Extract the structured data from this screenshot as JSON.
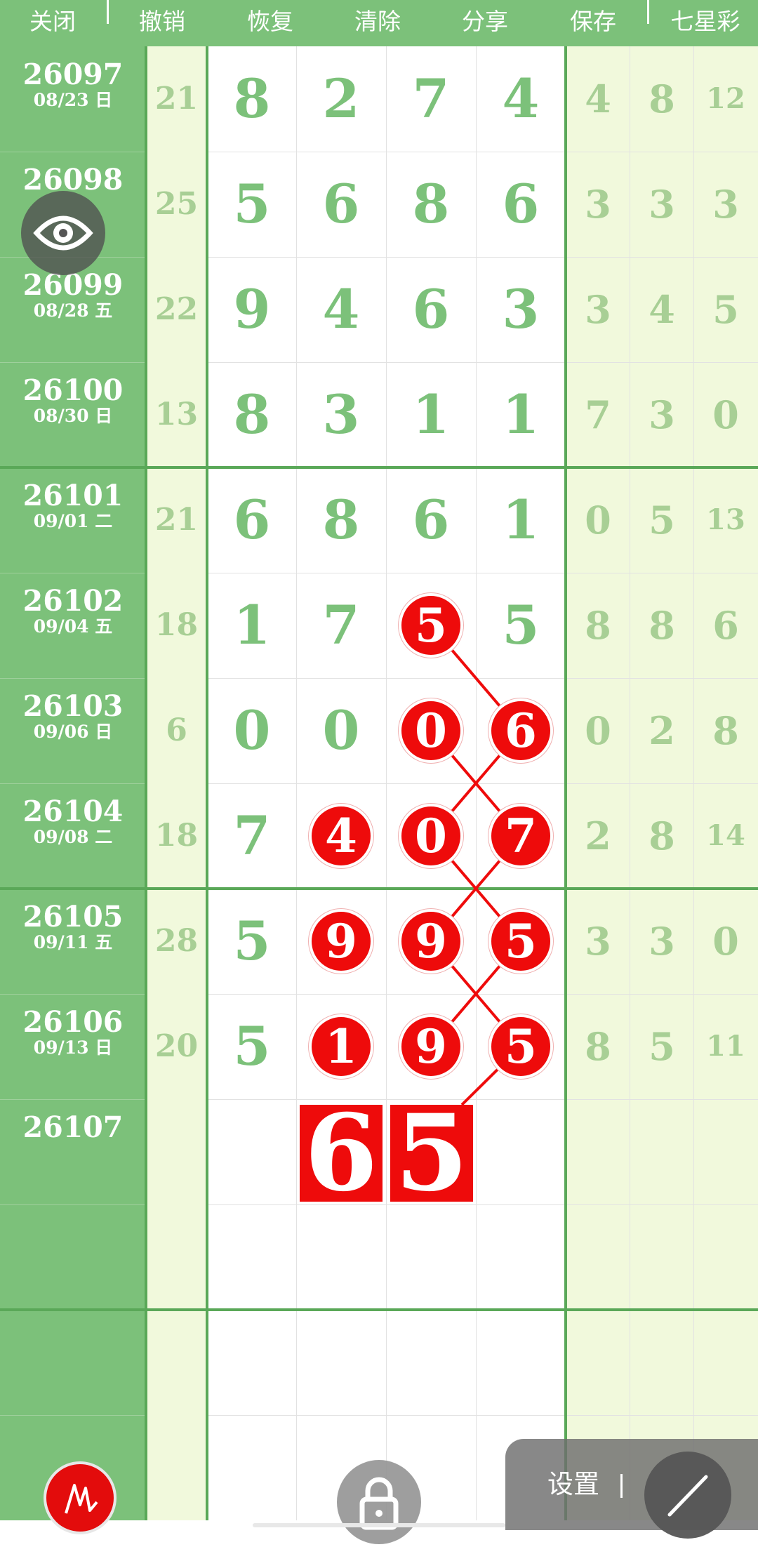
{
  "toolbar": {
    "close": "关闭",
    "undo": "撤销",
    "redo": "恢复",
    "clear": "清除",
    "share": "分享",
    "save": "保存",
    "lottery": "七星彩"
  },
  "rows": [
    {
      "issue": "26097",
      "date": "08/23 日",
      "sum": "21",
      "digits": [
        "8",
        "2",
        "7",
        "4"
      ],
      "side": [
        "4",
        "8",
        "12"
      ]
    },
    {
      "issue": "26098",
      "date": "",
      "sum": "25",
      "digits": [
        "5",
        "6",
        "8",
        "6"
      ],
      "side": [
        "3",
        "3",
        "3"
      ]
    },
    {
      "issue": "26099",
      "date": "08/28 五",
      "sum": "22",
      "digits": [
        "9",
        "4",
        "6",
        "3"
      ],
      "side": [
        "3",
        "4",
        "5"
      ]
    },
    {
      "issue": "26100",
      "date": "08/30 日",
      "sum": "13",
      "digits": [
        "8",
        "3",
        "1",
        "1"
      ],
      "side": [
        "7",
        "3",
        "0"
      ]
    },
    {
      "issue": "26101",
      "date": "09/01 二",
      "sum": "21",
      "digits": [
        "6",
        "8",
        "6",
        "1"
      ],
      "side": [
        "0",
        "5",
        "13"
      ]
    },
    {
      "issue": "26102",
      "date": "09/04 五",
      "sum": "18",
      "digits": [
        "1",
        "7",
        "5",
        "5"
      ],
      "side": [
        "8",
        "8",
        "6"
      ]
    },
    {
      "issue": "26103",
      "date": "09/06 日",
      "sum": "6",
      "digits": [
        "0",
        "0",
        "0",
        "6"
      ],
      "side": [
        "0",
        "2",
        "8"
      ]
    },
    {
      "issue": "26104",
      "date": "09/08 二",
      "sum": "18",
      "digits": [
        "7",
        "4",
        "0",
        "7"
      ],
      "side": [
        "2",
        "8",
        "14"
      ]
    },
    {
      "issue": "26105",
      "date": "09/11 五",
      "sum": "28",
      "digits": [
        "5",
        "9",
        "9",
        "5"
      ],
      "side": [
        "3",
        "3",
        "0"
      ]
    },
    {
      "issue": "26106",
      "date": "09/13 日",
      "sum": "20",
      "digits": [
        "5",
        "1",
        "9",
        "5"
      ],
      "side": [
        "8",
        "5",
        "11"
      ]
    },
    {
      "issue": "26107",
      "date": "",
      "sum": "",
      "digits": [
        "",
        "",
        "",
        ""
      ],
      "side": [
        "",
        "",
        ""
      ]
    },
    {
      "issue": "",
      "date": "",
      "sum": "",
      "digits": [
        "",
        "",
        "",
        ""
      ],
      "side": [
        "",
        "",
        ""
      ]
    },
    {
      "issue": "",
      "date": "",
      "sum": "",
      "digits": [
        "",
        "",
        "",
        ""
      ],
      "side": [
        "",
        "",
        ""
      ]
    },
    {
      "issue": "",
      "date": "",
      "sum": "",
      "digits": [
        "",
        "",
        "",
        ""
      ],
      "side": [
        "",
        "",
        ""
      ]
    }
  ],
  "marks": {
    "circles": [
      [
        5,
        2
      ],
      [
        6,
        2
      ],
      [
        6,
        3
      ],
      [
        7,
        1
      ],
      [
        7,
        2
      ],
      [
        7,
        3
      ],
      [
        8,
        1
      ],
      [
        8,
        2
      ],
      [
        8,
        3
      ],
      [
        9,
        1
      ],
      [
        9,
        2
      ],
      [
        9,
        3
      ]
    ],
    "prediction": {
      "row": 10,
      "cols": [
        1,
        2
      ],
      "values": [
        "6",
        "5"
      ]
    }
  },
  "colors": {
    "accent": "#7cc17a",
    "light": "#f1f9dc",
    "mark": "#ee0b0b"
  },
  "icons": {
    "eye": "eye-icon",
    "pen": "pen-icon",
    "lock": "lock-icon",
    "line": "line-tool-icon"
  },
  "controls": {
    "settings": "设置"
  }
}
